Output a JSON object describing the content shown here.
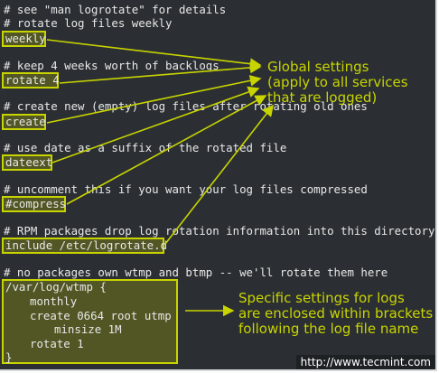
{
  "colors": {
    "terminal_bg": "#2b2f33",
    "text": "#e8e8e8",
    "accent": "#c8d400"
  },
  "lines": {
    "l1": "# see \"man logrotate\" for details",
    "l2": "# rotate log files weekly",
    "l3": "# keep 4 weeks worth of backlogs",
    "l4": "# create new (empty) log files after rotating old ones",
    "l5": "# use date as a suffix of the rotated file",
    "l6": "# uncomment this if you want your log files compressed",
    "l7": "# RPM packages drop log rotation information into this directory",
    "l8": "# no packages own wtmp and btmp -- we'll rotate them here"
  },
  "highlights": {
    "weekly": "weekly",
    "rotate": "rotate 4",
    "create": "create",
    "dateext": "dateext",
    "compress": "#compress",
    "include": "include /etc/logrotate.d"
  },
  "block": {
    "b1": "/var/log/wtmp {",
    "b2": "monthly",
    "b3": "create 0664 root utmp",
    "b4": "minsize 1M",
    "b5": "rotate 1",
    "b6": "}"
  },
  "notes": {
    "global_1": "Global settings",
    "global_2": "(apply to all services",
    "global_3": "that are logged)",
    "specific_1": "Specific settings for logs",
    "specific_2": "are enclosed within brackets",
    "specific_3": "following the log file name"
  },
  "watermark": "http://www.tecmint.com"
}
